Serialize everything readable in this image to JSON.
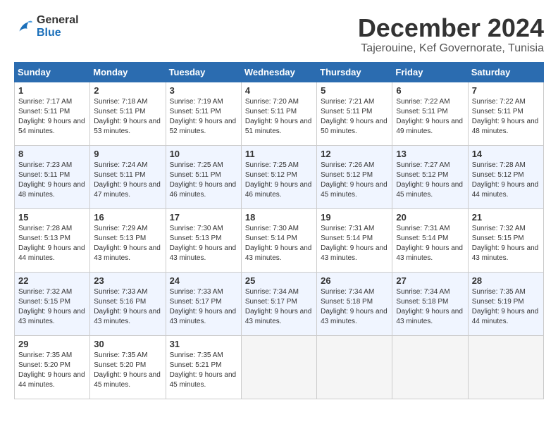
{
  "header": {
    "logo_line1": "General",
    "logo_line2": "Blue",
    "month": "December 2024",
    "location": "Tajerouine, Kef Governorate, Tunisia"
  },
  "days_of_week": [
    "Sunday",
    "Monday",
    "Tuesday",
    "Wednesday",
    "Thursday",
    "Friday",
    "Saturday"
  ],
  "weeks": [
    [
      {
        "day": 1,
        "sunrise": "7:17 AM",
        "sunset": "5:11 PM",
        "daylight": "9 hours and 54 minutes."
      },
      {
        "day": 2,
        "sunrise": "7:18 AM",
        "sunset": "5:11 PM",
        "daylight": "9 hours and 53 minutes."
      },
      {
        "day": 3,
        "sunrise": "7:19 AM",
        "sunset": "5:11 PM",
        "daylight": "9 hours and 52 minutes."
      },
      {
        "day": 4,
        "sunrise": "7:20 AM",
        "sunset": "5:11 PM",
        "daylight": "9 hours and 51 minutes."
      },
      {
        "day": 5,
        "sunrise": "7:21 AM",
        "sunset": "5:11 PM",
        "daylight": "9 hours and 50 minutes."
      },
      {
        "day": 6,
        "sunrise": "7:22 AM",
        "sunset": "5:11 PM",
        "daylight": "9 hours and 49 minutes."
      },
      {
        "day": 7,
        "sunrise": "7:22 AM",
        "sunset": "5:11 PM",
        "daylight": "9 hours and 48 minutes."
      }
    ],
    [
      {
        "day": 8,
        "sunrise": "7:23 AM",
        "sunset": "5:11 PM",
        "daylight": "9 hours and 48 minutes."
      },
      {
        "day": 9,
        "sunrise": "7:24 AM",
        "sunset": "5:11 PM",
        "daylight": "9 hours and 47 minutes."
      },
      {
        "day": 10,
        "sunrise": "7:25 AM",
        "sunset": "5:11 PM",
        "daylight": "9 hours and 46 minutes."
      },
      {
        "day": 11,
        "sunrise": "7:25 AM",
        "sunset": "5:12 PM",
        "daylight": "9 hours and 46 minutes."
      },
      {
        "day": 12,
        "sunrise": "7:26 AM",
        "sunset": "5:12 PM",
        "daylight": "9 hours and 45 minutes."
      },
      {
        "day": 13,
        "sunrise": "7:27 AM",
        "sunset": "5:12 PM",
        "daylight": "9 hours and 45 minutes."
      },
      {
        "day": 14,
        "sunrise": "7:28 AM",
        "sunset": "5:12 PM",
        "daylight": "9 hours and 44 minutes."
      }
    ],
    [
      {
        "day": 15,
        "sunrise": "7:28 AM",
        "sunset": "5:13 PM",
        "daylight": "9 hours and 44 minutes."
      },
      {
        "day": 16,
        "sunrise": "7:29 AM",
        "sunset": "5:13 PM",
        "daylight": "9 hours and 43 minutes."
      },
      {
        "day": 17,
        "sunrise": "7:30 AM",
        "sunset": "5:13 PM",
        "daylight": "9 hours and 43 minutes."
      },
      {
        "day": 18,
        "sunrise": "7:30 AM",
        "sunset": "5:14 PM",
        "daylight": "9 hours and 43 minutes."
      },
      {
        "day": 19,
        "sunrise": "7:31 AM",
        "sunset": "5:14 PM",
        "daylight": "9 hours and 43 minutes."
      },
      {
        "day": 20,
        "sunrise": "7:31 AM",
        "sunset": "5:14 PM",
        "daylight": "9 hours and 43 minutes."
      },
      {
        "day": 21,
        "sunrise": "7:32 AM",
        "sunset": "5:15 PM",
        "daylight": "9 hours and 43 minutes."
      }
    ],
    [
      {
        "day": 22,
        "sunrise": "7:32 AM",
        "sunset": "5:15 PM",
        "daylight": "9 hours and 43 minutes."
      },
      {
        "day": 23,
        "sunrise": "7:33 AM",
        "sunset": "5:16 PM",
        "daylight": "9 hours and 43 minutes."
      },
      {
        "day": 24,
        "sunrise": "7:33 AM",
        "sunset": "5:17 PM",
        "daylight": "9 hours and 43 minutes."
      },
      {
        "day": 25,
        "sunrise": "7:34 AM",
        "sunset": "5:17 PM",
        "daylight": "9 hours and 43 minutes."
      },
      {
        "day": 26,
        "sunrise": "7:34 AM",
        "sunset": "5:18 PM",
        "daylight": "9 hours and 43 minutes."
      },
      {
        "day": 27,
        "sunrise": "7:34 AM",
        "sunset": "5:18 PM",
        "daylight": "9 hours and 43 minutes."
      },
      {
        "day": 28,
        "sunrise": "7:35 AM",
        "sunset": "5:19 PM",
        "daylight": "9 hours and 44 minutes."
      }
    ],
    [
      {
        "day": 29,
        "sunrise": "7:35 AM",
        "sunset": "5:20 PM",
        "daylight": "9 hours and 44 minutes."
      },
      {
        "day": 30,
        "sunrise": "7:35 AM",
        "sunset": "5:20 PM",
        "daylight": "9 hours and 45 minutes."
      },
      {
        "day": 31,
        "sunrise": "7:35 AM",
        "sunset": "5:21 PM",
        "daylight": "9 hours and 45 minutes."
      },
      null,
      null,
      null,
      null
    ]
  ]
}
